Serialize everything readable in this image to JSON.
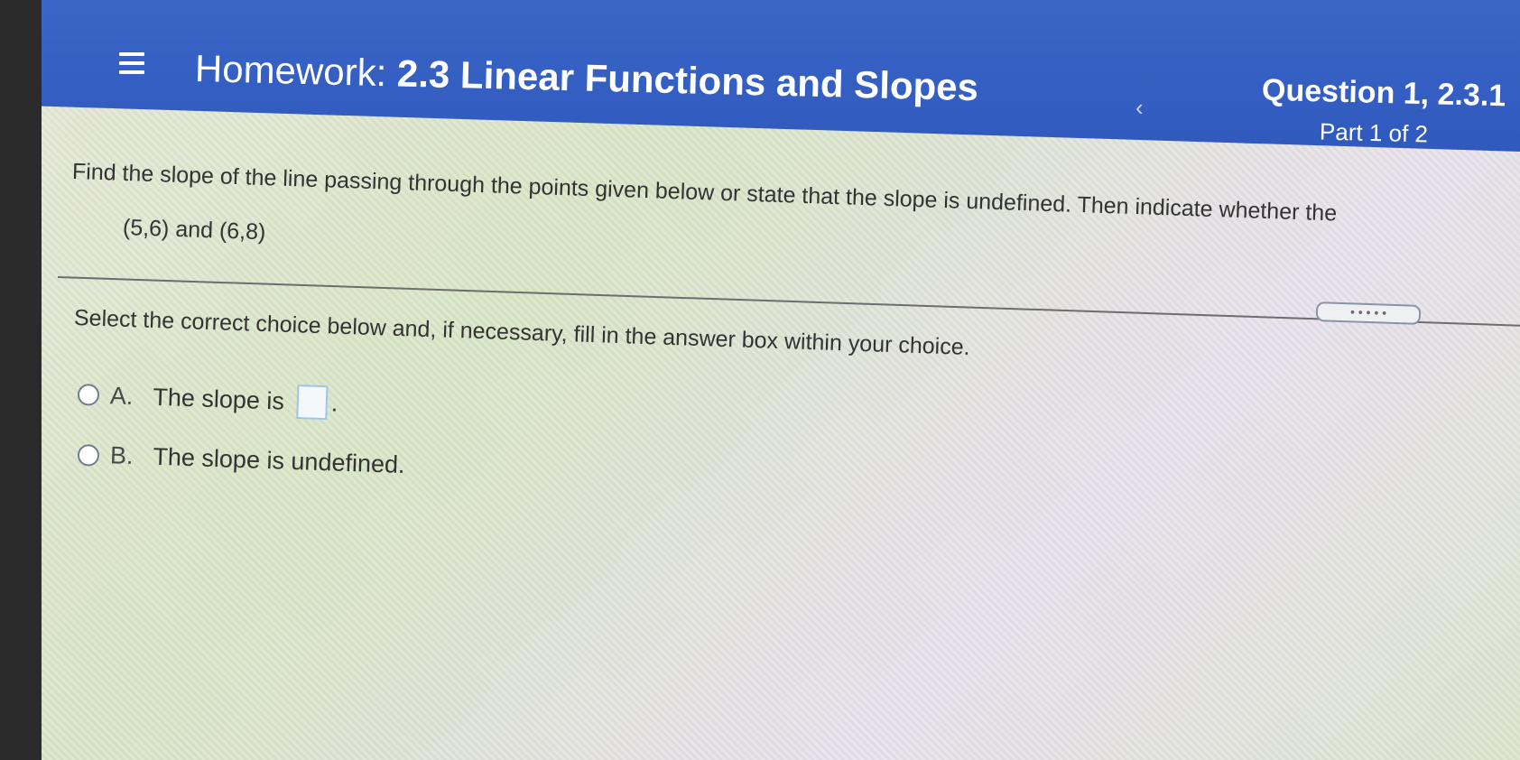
{
  "header": {
    "menu_icon": "hamburger-menu-icon",
    "title_prefix": "Homework:",
    "title_name": "2.3 Linear Functions and Slopes",
    "back_icon": "chevron-left-icon",
    "back_glyph": "‹",
    "question_label": "Question 1, 2.3.1",
    "part_label": "Part 1 of 2",
    "color": "#3a66c8"
  },
  "question": {
    "prompt": "Find the slope of the line passing through the points given below or state that the slope is undefined. Then indicate whether the",
    "points": "(5,6) and (6,8)",
    "more_button_label": "• • • • •",
    "instruction": "Select the correct choice below and, if necessary, fill in the answer box within your choice."
  },
  "choices": [
    {
      "letter": "A.",
      "text": "The slope is",
      "suffix": ".",
      "has_answer_box": true,
      "answer_value": ""
    },
    {
      "letter": "B.",
      "text": "The slope is undefined.",
      "has_answer_box": false
    }
  ]
}
